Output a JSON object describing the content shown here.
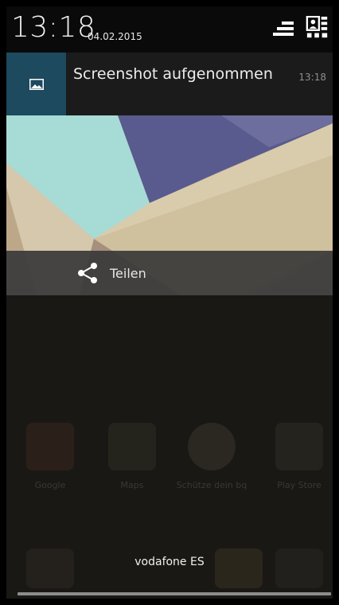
{
  "status_bar": {
    "time": "13:18",
    "date": "04.02.2015",
    "icons": [
      "quick-settings-bars-icon",
      "user-grid-icon"
    ]
  },
  "notification": {
    "title": "Screenshot aufgenommen",
    "time": "13:18",
    "icon": "image-icon",
    "icon_bg": "#1d4a5e"
  },
  "actions": {
    "share_label": "Teilen",
    "share_icon": "share-icon"
  },
  "carrier": "vodafone ES",
  "background_apps": [
    {
      "label": "Google"
    },
    {
      "label": "Maps"
    },
    {
      "label": "Schütze dein bq"
    },
    {
      "label": "Play Store"
    }
  ]
}
